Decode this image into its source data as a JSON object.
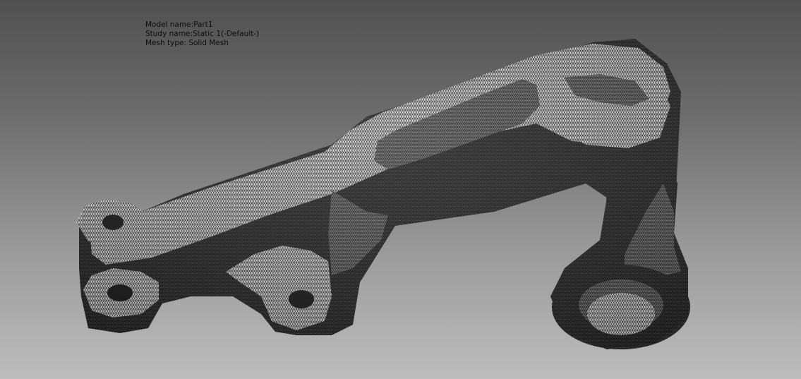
{
  "info": {
    "model_name": "Model name:Part1",
    "study_name": "Study name:Static 1(-Default-)",
    "mesh_type": "Mesh type: Solid Mesh"
  },
  "colors": {
    "mesh_light": "#cfcfcf",
    "mesh_dark": "#1a1a1a",
    "background_top": "#505050",
    "background_bottom": "#bdbdbd"
  }
}
